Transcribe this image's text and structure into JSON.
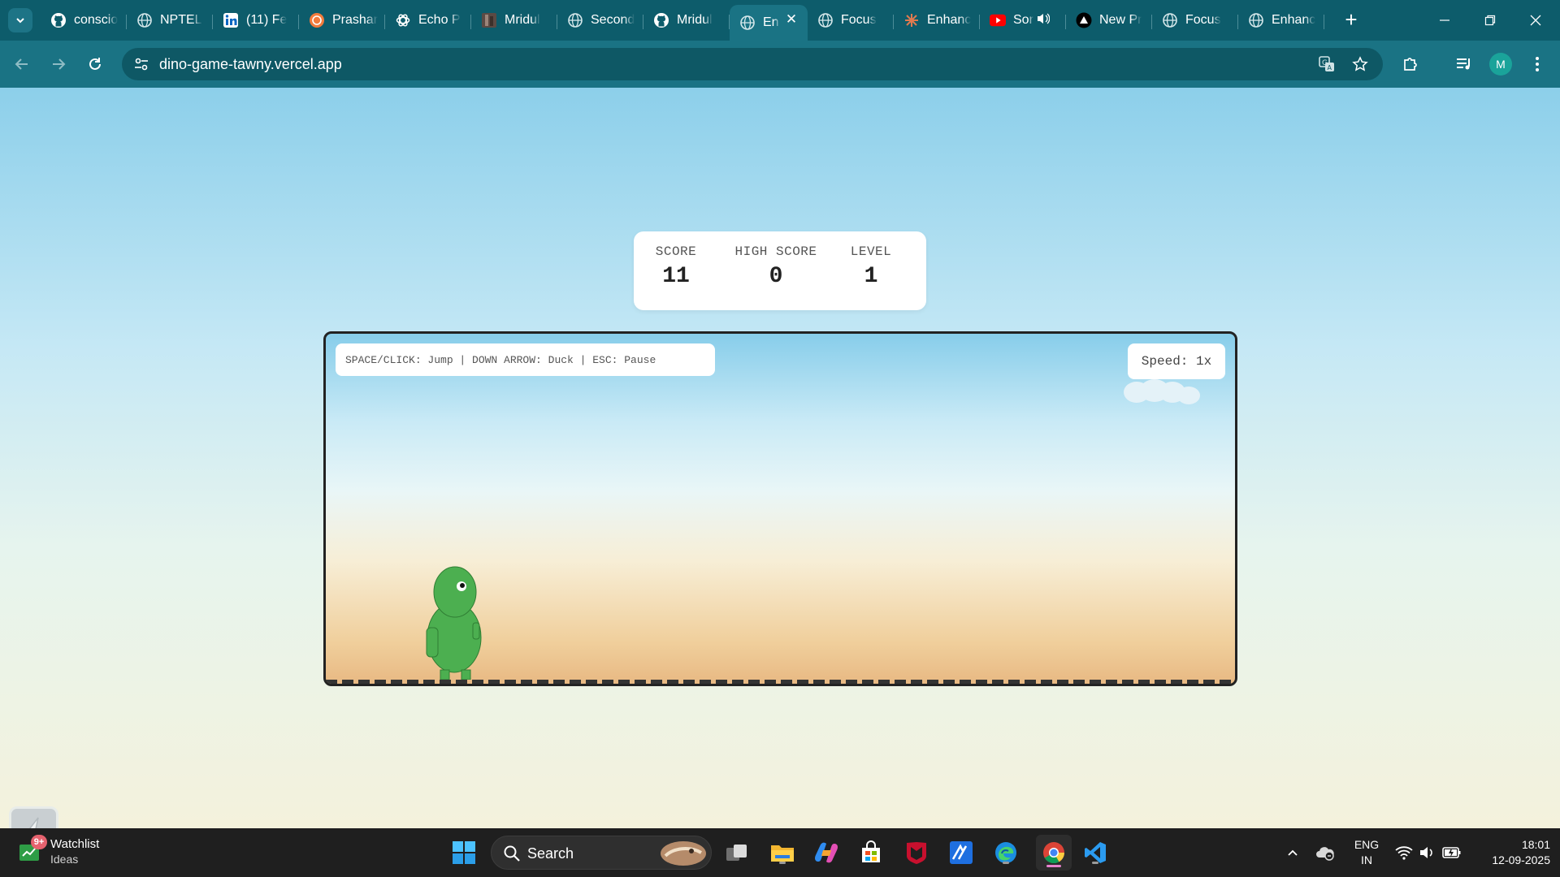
{
  "browser": {
    "tabs": [
      {
        "title": "conscio",
        "icon": "github-icon"
      },
      {
        "title": "NPTEL",
        "icon": "globe-icon"
      },
      {
        "title": "(11) Fe",
        "icon": "linkedin-icon"
      },
      {
        "title": "Prashar",
        "icon": "portfolio-icon"
      },
      {
        "title": "Echo P",
        "icon": "openai-icon"
      },
      {
        "title": "Mridul",
        "icon": "photo-icon"
      },
      {
        "title": "Second",
        "icon": "globe-icon"
      },
      {
        "title": "Mridul",
        "icon": "github-icon"
      },
      {
        "title": "En",
        "icon": "globe-icon",
        "active": true
      },
      {
        "title": "Focus",
        "icon": "globe-icon"
      },
      {
        "title": "Enhanc",
        "icon": "claude-icon"
      },
      {
        "title": "Sor",
        "icon": "youtube-icon",
        "audio": true
      },
      {
        "title": "New Pr",
        "icon": "vercel-icon"
      },
      {
        "title": "Focus",
        "icon": "globe-icon"
      },
      {
        "title": "Enhanc",
        "icon": "globe-icon"
      }
    ],
    "url": "dino-game-tawny.vercel.app",
    "profile_initial": "M"
  },
  "game": {
    "score_label": "SCORE",
    "score": "11",
    "high_score_label": "HIGH SCORE",
    "high_score": "0",
    "level_label": "LEVEL",
    "level": "1",
    "controls_hint": "SPACE/CLICK: Jump | DOWN ARROW: Duck | ESC: Pause",
    "speed": "Speed: 1x"
  },
  "taskbar": {
    "widget_badge": "9+",
    "widget_title": "Watchlist",
    "widget_subtitle": "Ideas",
    "search_label": "Search",
    "lang_1": "ENG",
    "lang_2": "IN",
    "time": "18:01",
    "date": "12-09-2025"
  },
  "colors": {
    "tabstrip": "#0d5c6b",
    "toolbar": "#1a7384",
    "dino": "#4caf50",
    "taskbar": "#1f1f1f"
  }
}
